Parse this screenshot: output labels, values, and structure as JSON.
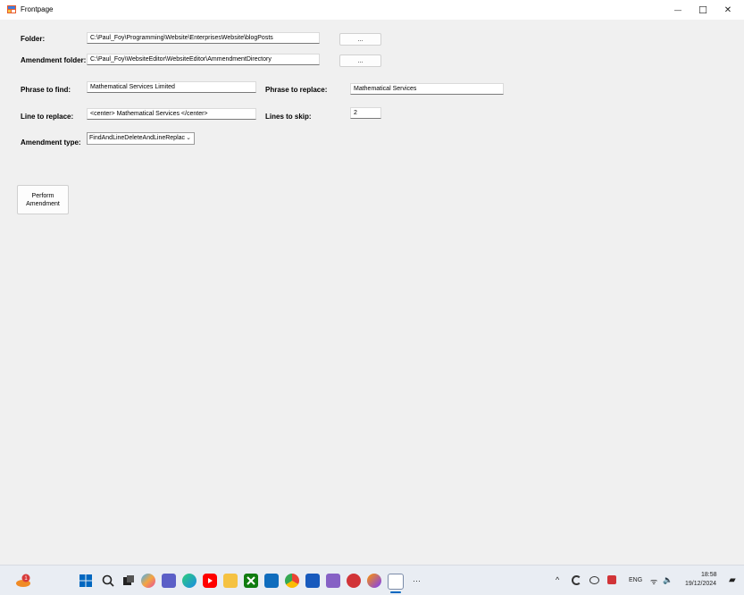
{
  "window": {
    "title": "Frontpage",
    "minimize_glyph": "—",
    "maximize_glyph": "☐",
    "close_glyph": "✕"
  },
  "form": {
    "folder_label": "Folder:",
    "folder_value": "C:\\Paul_Foy\\Programming\\Website\\EnterprisesWebsite\\blogPosts",
    "folder_browse": "...",
    "amendment_folder_label": "Amendment folder:",
    "amendment_folder_value": "C:\\Paul_Foy\\WebsiteEditor\\WebsiteEditor\\AmmendmentDirectory",
    "amendment_browse": "...",
    "phrase_find_label": "Phrase to find:",
    "phrase_find_value": "Mathematical Services Limited",
    "phrase_replace_label": "Phrase to replace:",
    "phrase_replace_value": "Mathematical Services",
    "line_replace_label": "Line to replace:",
    "line_replace_value": "<center> Mathematical Services </center>",
    "lines_skip_label": "Lines to skip:",
    "lines_skip_value": "2",
    "amendment_type_label": "Amendment type:",
    "amendment_type_value": "FindAndLineDeleteAndLineReplac",
    "perform_line1": "Perform",
    "perform_line2": "Amendment"
  },
  "taskbar": {
    "icons": [
      "weather-icon",
      "windows-start-icon",
      "search-icon",
      "task-view-icon",
      "copilot-icon",
      "teams-icon",
      "edge-icon",
      "youtube-icon",
      "file-explorer-icon",
      "xbox-icon",
      "store-icon",
      "chrome-icon",
      "word-icon",
      "visual-studio-icon",
      "app-red-icon",
      "firefox-icon",
      "active-app-icon"
    ],
    "overflow": "···",
    "tray_chevron": "^",
    "language": "ENG",
    "time": "18:58",
    "date": "19/12/2024",
    "weather_badge": "1"
  },
  "colors": {
    "accent": "#0067c0",
    "window_bg": "#f0f0f0",
    "taskbar_bg": "#e9edf3"
  }
}
